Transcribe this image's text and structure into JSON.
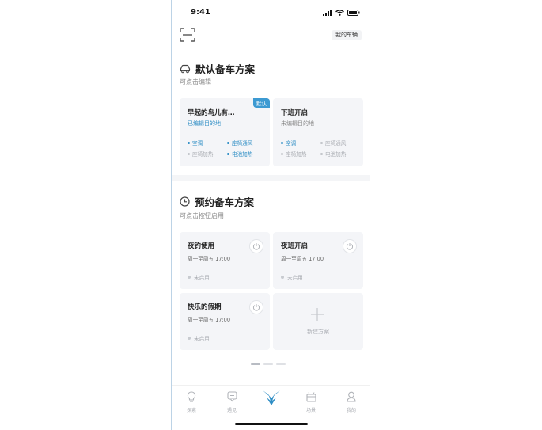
{
  "status_bar": {
    "time": "9:41"
  },
  "header": {
    "my_car_label": "我的车辆"
  },
  "default_section": {
    "title": "默认备车方案",
    "subtitle": "可点击编辑",
    "cards": [
      {
        "name": "早起的鸟儿有…",
        "badge": "默认",
        "destination": "已编辑目的地",
        "features": [
          {
            "label": "空调",
            "enabled": true
          },
          {
            "label": "座椅通风",
            "enabled": true
          },
          {
            "label": "座椅加热",
            "enabled": false
          },
          {
            "label": "电池加热",
            "enabled": true
          }
        ]
      },
      {
        "name": "下班开启",
        "destination": "未编辑目的地",
        "features": [
          {
            "label": "空调",
            "enabled": true
          },
          {
            "label": "座椅通风",
            "enabled": false
          },
          {
            "label": "座椅加热",
            "enabled": false
          },
          {
            "label": "电池加热",
            "enabled": false
          }
        ]
      }
    ]
  },
  "schedule_section": {
    "title": "预约备车方案",
    "subtitle": "可点击按钮启用",
    "cards": [
      {
        "name": "夜钓使用",
        "schedule": "周一至周五 17:00",
        "state": "未启用"
      },
      {
        "name": "夜班开启",
        "schedule": "周一至周五 17:00",
        "state": "未启用"
      },
      {
        "name": "快乐的假期",
        "schedule": "周一至周五 17:00",
        "state": "未启用"
      }
    ],
    "new_plan_label": "新建方案"
  },
  "pager": {
    "count": 3,
    "active_index": 0
  },
  "tabbar": {
    "items": [
      {
        "label": "探索",
        "icon": "bulb-icon"
      },
      {
        "label": "遇见",
        "icon": "chat-icon"
      },
      {
        "label": "",
        "icon": "brand-logo-icon"
      },
      {
        "label": "场景",
        "icon": "gift-icon"
      },
      {
        "label": "我的",
        "icon": "user-icon"
      }
    ]
  },
  "colors": {
    "accent": "#2f8ec5",
    "badge": "#3d9ad2",
    "card_bg": "#f4f5f8"
  }
}
